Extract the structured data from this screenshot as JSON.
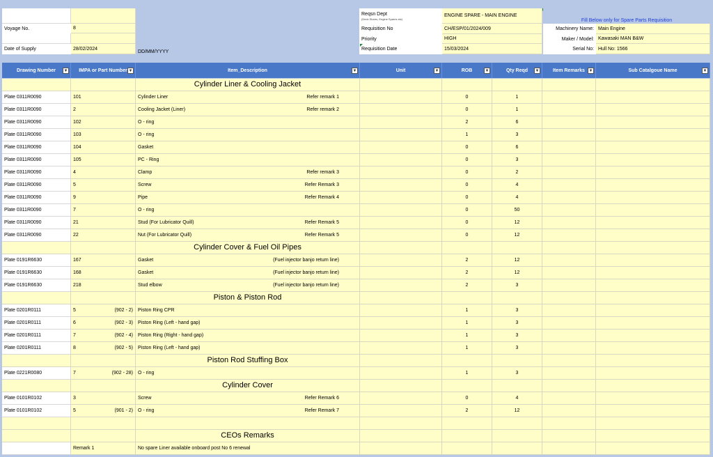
{
  "header": {
    "voyage_label": "Voyage No.",
    "voyage_value": "8",
    "supply_label": "Date of Supply",
    "supply_value": "28/02/2024",
    "date_format_hint": "DD/MM/YYYY",
    "reqsn_dept_label": "Reqsn Dept",
    "reqsn_dept_sub": "(Deck Stores, Engine Spares etc)",
    "reqsn_dept_value": "ENGINE SPARE - MAIN ENGINE",
    "requisition_no_label": "Requisition No",
    "requisition_no_value": "CH/ESP/01/2024/009",
    "priority_label": "Priority",
    "priority_value": "HIGH",
    "requisition_date_label": "Requisition Date",
    "requisition_date_value": "15/03/2024",
    "fill_below_note": "Fill Below only for Spare Parts Requisition",
    "machinery_label": "Machinery Name:",
    "machinery_value": "Main Engine",
    "maker_label": "Maker / Model:",
    "maker_value": "Kawasaki MAN B&W",
    "serial_label": "Serial No:",
    "serial_value": "Hull No: 1566"
  },
  "columns": [
    "Drawing Number",
    "IMPA or Part Number",
    "Item_Description",
    "Unit",
    "ROB",
    "Qty Reqd",
    "Item Remarks",
    "Sub Catalgoue Name"
  ],
  "icons": {
    "dropdown": "▼"
  },
  "rows": [
    {
      "type": "section",
      "title": "Cylinder Liner & Cooling Jacket"
    },
    {
      "type": "item",
      "drawing": "Plate 0311R0090",
      "part": "101",
      "part_note": "",
      "desc": "Cylinder Liner",
      "remark": "Refer remark 1",
      "rob": "0",
      "qty": "1"
    },
    {
      "type": "item",
      "drawing": "Plate 0311R0090",
      "part": "2",
      "part_note": "",
      "desc": "Cooling Jacket (Liner)",
      "remark": "Refer remark 2",
      "rob": "0",
      "qty": "1"
    },
    {
      "type": "item",
      "drawing": "Plate 0311R0090",
      "part": "102",
      "part_note": "",
      "desc": "O - ring",
      "remark": "",
      "rob": "2",
      "qty": "6"
    },
    {
      "type": "item",
      "drawing": "Plate 0311R0090",
      "part": "103",
      "part_note": "",
      "desc": "O - ring",
      "remark": "",
      "rob": "1",
      "qty": "3"
    },
    {
      "type": "item",
      "drawing": "Plate 0311R0090",
      "part": "104",
      "part_note": "",
      "desc": "Gasket",
      "remark": "",
      "rob": "0",
      "qty": "6"
    },
    {
      "type": "item",
      "drawing": "Plate 0311R0090",
      "part": "105",
      "part_note": "",
      "desc": "PC - Ring",
      "remark": "",
      "rob": "0",
      "qty": "3"
    },
    {
      "type": "item",
      "drawing": "Plate 0311R0090",
      "part": "4",
      "part_note": "",
      "desc": "Clamp",
      "remark": "Refer remark 3",
      "rob": "0",
      "qty": "2"
    },
    {
      "type": "item",
      "drawing": "Plate 0311R0090",
      "part": "5",
      "part_note": "",
      "desc": "Screw",
      "remark": "Refer Remark 3",
      "rob": "0",
      "qty": "4"
    },
    {
      "type": "item",
      "drawing": "Plate 0311R0090",
      "part": "9",
      "part_note": "",
      "desc": "Pipe",
      "remark": "Refer Remark 4",
      "rob": "0",
      "qty": "4"
    },
    {
      "type": "item",
      "drawing": "Plate 0311R0090",
      "part": "7",
      "part_note": "",
      "desc": "O - ring",
      "remark": "",
      "rob": "0",
      "qty": "50"
    },
    {
      "type": "item",
      "drawing": "Plate 0311R0090",
      "part": "21",
      "part_note": "",
      "desc": "Stud (For Lubricator Quill)",
      "remark": "Refer Remark 5",
      "rob": "0",
      "qty": "12"
    },
    {
      "type": "item",
      "drawing": "Plate 0311R0090",
      "part": "22",
      "part_note": "",
      "desc": "Nut (For Lubricator Quill)",
      "remark": "Refer Remark 5",
      "rob": "0",
      "qty": "12"
    },
    {
      "type": "section",
      "title": "Cylinder Cover & Fuel Oil Pipes"
    },
    {
      "type": "item",
      "drawing": "Plate 0191R6630",
      "part": "167",
      "part_note": "",
      "desc": "Gasket",
      "remark": "(Fuel injector banjo return line)",
      "rob": "2",
      "qty": "12"
    },
    {
      "type": "item",
      "drawing": "Plate 0191R6630",
      "part": "168",
      "part_note": "",
      "desc": "Gasket",
      "remark": "(Fuel injector banjo return line)",
      "rob": "2",
      "qty": "12"
    },
    {
      "type": "item",
      "drawing": "Plate 0191R6630",
      "part": "218",
      "part_note": "",
      "desc": "Stud elbow",
      "remark": "(Fuel injector banjo return line)",
      "rob": "2",
      "qty": "3"
    },
    {
      "type": "section",
      "title": "Piston & Piston Rod"
    },
    {
      "type": "item",
      "drawing": "Plate 0201R0111",
      "part": "5",
      "part_note": "(902 - 2)",
      "desc": "Piston Ring CPR",
      "remark": "",
      "rob": "1",
      "qty": "3"
    },
    {
      "type": "item",
      "drawing": "Plate 0201R0111",
      "part": "6",
      "part_note": "(902 - 3)",
      "desc": "Piston Ring (Left - hand gap)",
      "remark": "",
      "rob": "1",
      "qty": "3"
    },
    {
      "type": "item",
      "drawing": "Plate 0201R0111",
      "part": "7",
      "part_note": "(902 - 4)",
      "desc": "Piston Ring (Right - hand gap)",
      "remark": "",
      "rob": "1",
      "qty": "3"
    },
    {
      "type": "item",
      "drawing": "Plate 0201R0111",
      "part": "8",
      "part_note": "(902 - 5)",
      "desc": "Piston Ring (Left - hand gap)",
      "remark": "",
      "rob": "1",
      "qty": "3"
    },
    {
      "type": "section",
      "title": "Piston Rod Stuffing Box"
    },
    {
      "type": "item",
      "drawing": "Plate 0221R0080",
      "part": "7",
      "part_note": "(902 - 28)",
      "desc": "O - ring",
      "remark": "",
      "rob": "1",
      "qty": "3"
    },
    {
      "type": "section",
      "title": "Cylinder Cover"
    },
    {
      "type": "item",
      "drawing": "Plate 0101R0102",
      "part": "3",
      "part_note": "",
      "desc": "Screw",
      "remark": "Refer Remark 6",
      "rob": "0",
      "qty": "4"
    },
    {
      "type": "item",
      "drawing": "Plate 0101R0102",
      "part": "5",
      "part_note": "(901 - 2)",
      "desc": "O - ring",
      "remark": "Refer Remark 7",
      "rob": "2",
      "qty": "12"
    },
    {
      "type": "blank"
    },
    {
      "type": "section",
      "title": "CEOs Remarks"
    },
    {
      "type": "note",
      "label": "Remark 1",
      "text": "No spare Liner available onboard post No 6 renewal"
    }
  ]
}
